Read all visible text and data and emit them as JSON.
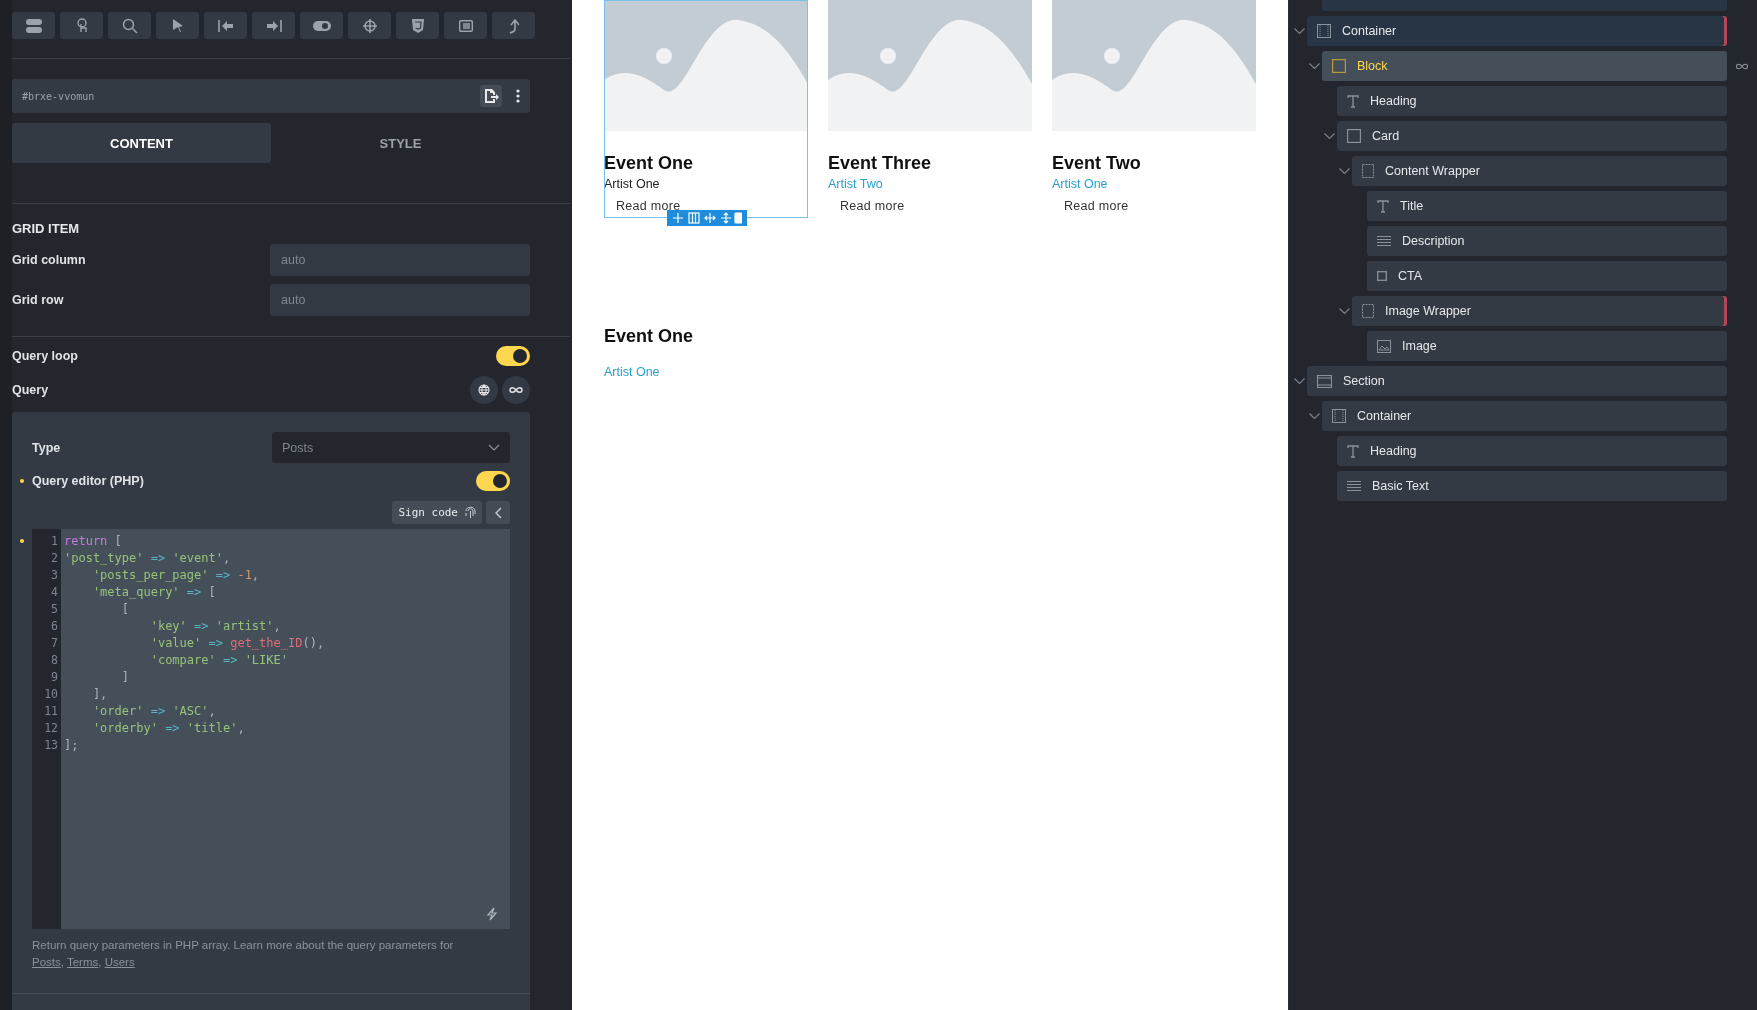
{
  "settings_panel": {
    "element_id": "#brxe-vvomun",
    "tabs": [
      {
        "label": "CONTENT",
        "selected": true
      },
      {
        "label": "STYLE",
        "selected": false
      }
    ],
    "section_title": "GRID ITEM",
    "fields": [
      {
        "label": "Grid column",
        "placeholder": "auto"
      },
      {
        "label": "Grid row",
        "placeholder": "auto"
      }
    ],
    "query_loop": {
      "label": "Query loop",
      "on": true
    },
    "query": {
      "label": "Query"
    },
    "query_popup": {
      "type": {
        "label": "Type",
        "value": "Posts"
      },
      "query_editor": {
        "label": "Query editor (PHP)",
        "on": true,
        "modified": true
      },
      "sign_code": "Sign code",
      "code_editor": {
        "modified": true,
        "lines": [
          {
            "number": "1",
            "tokens": [
              {
                "kind": "keyword",
                "text": "return"
              },
              {
                "kind": "plain",
                "text": " ["
              }
            ]
          },
          {
            "number": "2",
            "tokens": [
              {
                "kind": "string",
                "text": "'post_type'"
              },
              {
                "kind": "operator",
                "text": " => "
              },
              {
                "kind": "string",
                "text": "'event'"
              },
              {
                "kind": "plain",
                "text": ","
              }
            ]
          },
          {
            "number": "3",
            "tokens": [
              {
                "kind": "string",
                "text": "    'posts_per_page'"
              },
              {
                "kind": "operator",
                "text": " => "
              },
              {
                "kind": "number",
                "text": "-1"
              },
              {
                "kind": "plain",
                "text": ","
              }
            ]
          },
          {
            "number": "4",
            "tokens": [
              {
                "kind": "string",
                "text": "    'meta_query'"
              },
              {
                "kind": "operator",
                "text": " => "
              },
              {
                "kind": "plain",
                "text": "["
              }
            ]
          },
          {
            "number": "5",
            "tokens": [
              {
                "kind": "plain",
                "text": "        ["
              }
            ]
          },
          {
            "number": "6",
            "tokens": [
              {
                "kind": "string",
                "text": "            'key'"
              },
              {
                "kind": "operator",
                "text": " => "
              },
              {
                "kind": "string",
                "text": "'artist'"
              },
              {
                "kind": "plain",
                "text": ","
              }
            ]
          },
          {
            "number": "7",
            "tokens": [
              {
                "kind": "string",
                "text": "            'value'"
              },
              {
                "kind": "operator",
                "text": " => "
              },
              {
                "kind": "function",
                "text": "get_the_ID"
              },
              {
                "kind": "plain",
                "text": "(),"
              }
            ]
          },
          {
            "number": "8",
            "tokens": [
              {
                "kind": "string",
                "text": "            'compare'"
              },
              {
                "kind": "operator",
                "text": " => "
              },
              {
                "kind": "string",
                "text": "'LIKE'"
              }
            ]
          },
          {
            "number": "9",
            "tokens": [
              {
                "kind": "plain",
                "text": "        ]"
              }
            ]
          },
          {
            "number": "10",
            "tokens": [
              {
                "kind": "plain",
                "text": "    ],"
              }
            ]
          },
          {
            "number": "11",
            "tokens": [
              {
                "kind": "string",
                "text": "    'order'"
              },
              {
                "kind": "operator",
                "text": " => "
              },
              {
                "kind": "string",
                "text": "'ASC'"
              },
              {
                "kind": "plain",
                "text": ","
              }
            ]
          },
          {
            "number": "12",
            "tokens": [
              {
                "kind": "string",
                "text": "    'orderby'"
              },
              {
                "kind": "operator",
                "text": " => "
              },
              {
                "kind": "string",
                "text": "'title'"
              },
              {
                "kind": "plain",
                "text": ","
              }
            ]
          },
          {
            "number": "13",
            "tokens": [
              {
                "kind": "plain",
                "text": "];"
              }
            ]
          }
        ]
      },
      "help": {
        "text": "Return query parameters in PHP array. Learn more about the query parameters for",
        "separator": ", ",
        "links": [
          "Posts",
          "Terms",
          "Users"
        ]
      }
    }
  },
  "canvas": {
    "cards": [
      {
        "title": "Event One",
        "subtitle": "Artist One",
        "subtitle_linked": false,
        "cta": "Read more",
        "selected": true
      },
      {
        "title": "Event Three",
        "subtitle": "Artist Two",
        "subtitle_linked": true,
        "cta": "Read more",
        "selected": false
      },
      {
        "title": "Event Two",
        "subtitle": "Artist One",
        "subtitle_linked": true,
        "cta": "Read more",
        "selected": false
      }
    ],
    "heading": "Event One",
    "link": "Artist One"
  },
  "structure": [
    {
      "label": "Container",
      "kind": "container",
      "selected": false,
      "highlighted": true,
      "flagged": true,
      "expanded": true,
      "children": [
        {
          "label": "Block",
          "kind": "block",
          "selected": true,
          "highlighted": false,
          "flagged": false,
          "expanded": true,
          "loop": true,
          "children": [
            {
              "label": "Heading",
              "kind": "heading",
              "selected": false,
              "highlighted": false,
              "flagged": false,
              "expanded": false
            },
            {
              "label": "Card",
              "kind": "block",
              "selected": false,
              "highlighted": false,
              "flagged": false,
              "expanded": true,
              "children": [
                {
                  "label": "Content Wrapper",
                  "kind": "div",
                  "selected": false,
                  "highlighted": false,
                  "flagged": false,
                  "expanded": true,
                  "children": [
                    {
                      "label": "Title",
                      "kind": "heading",
                      "selected": false,
                      "highlighted": false,
                      "flagged": false,
                      "expanded": false
                    },
                    {
                      "label": "Description",
                      "kind": "text",
                      "selected": false,
                      "highlighted": false,
                      "flagged": false,
                      "expanded": false
                    },
                    {
                      "label": "CTA",
                      "kind": "button",
                      "selected": false,
                      "highlighted": false,
                      "flagged": false,
                      "expanded": false
                    }
                  ]
                },
                {
                  "label": "Image Wrapper",
                  "kind": "div",
                  "selected": false,
                  "highlighted": false,
                  "flagged": true,
                  "expanded": true,
                  "children": [
                    {
                      "label": "Image",
                      "kind": "image",
                      "selected": false,
                      "highlighted": false,
                      "flagged": false,
                      "expanded": false
                    }
                  ]
                }
              ]
            }
          ]
        }
      ]
    },
    {
      "label": "Section",
      "kind": "section",
      "selected": false,
      "highlighted": false,
      "flagged": false,
      "expanded": true,
      "children": [
        {
          "label": "Container",
          "kind": "container",
          "selected": false,
          "highlighted": false,
          "flagged": false,
          "expanded": true,
          "children": [
            {
              "label": "Heading",
              "kind": "heading",
              "selected": false,
              "highlighted": false,
              "flagged": false,
              "expanded": false
            },
            {
              "label": "Basic Text",
              "kind": "text",
              "selected": false,
              "highlighted": false,
              "flagged": false,
              "expanded": false
            }
          ]
        }
      ]
    }
  ]
}
